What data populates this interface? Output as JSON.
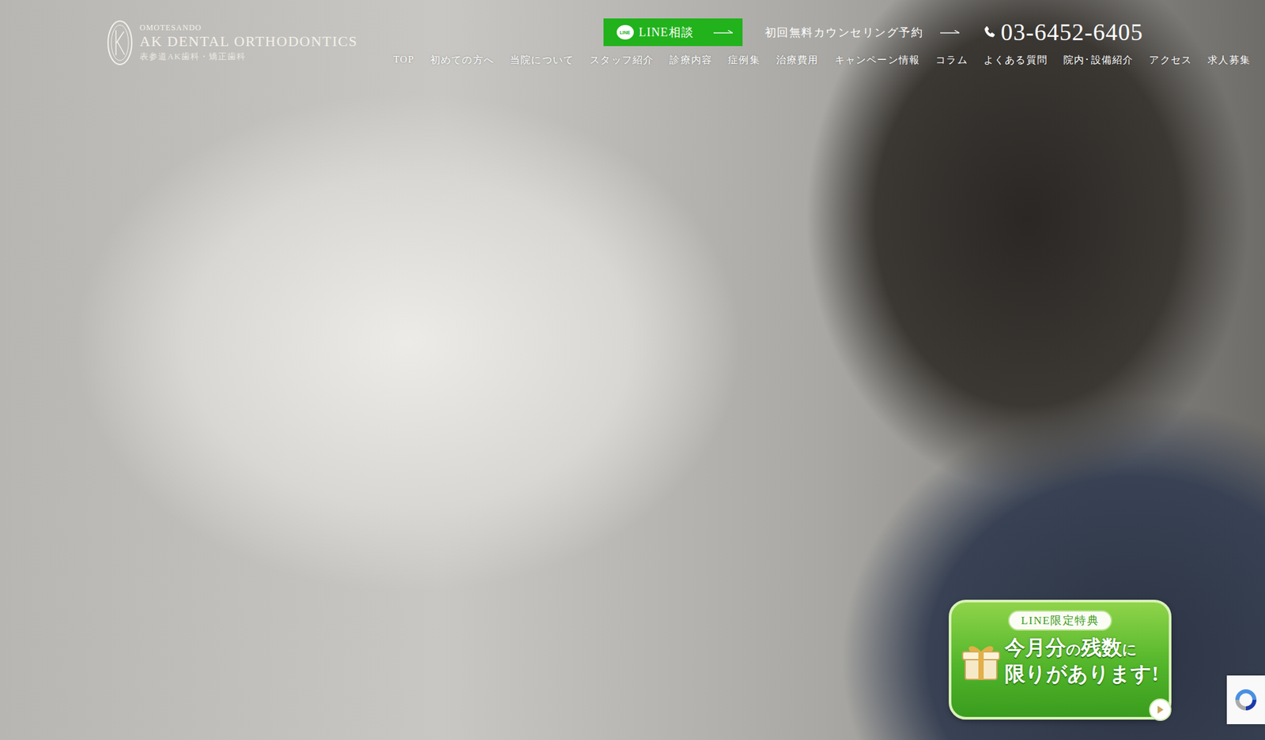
{
  "logo": {
    "area": "OMOTESANDO",
    "name": "AK DENTAL ORTHODONTICS",
    "subtitle": "表参道AK歯科・矯正歯科"
  },
  "header": {
    "line_icon": "LINE",
    "line_button": "LINE相談",
    "reservation": "初回無料カウンセリング予約",
    "phone": "03-6452-6405"
  },
  "nav": [
    {
      "label": "TOP",
      "selected": false
    },
    {
      "label": "初めての方へ",
      "selected": false
    },
    {
      "label": "当院について",
      "selected": false
    },
    {
      "label": "スタッフ紹介",
      "selected": false
    },
    {
      "label": "診療内容",
      "selected": false
    },
    {
      "label": "症例集",
      "selected": false
    },
    {
      "label": "治療費用",
      "selected": false
    },
    {
      "label": "キャンペーン情報",
      "selected": false
    },
    {
      "label": "コラム",
      "selected": false
    },
    {
      "label": "よくある質問",
      "selected": false
    },
    {
      "label": "院内･設備紹介",
      "selected": false
    },
    {
      "label": "アクセス",
      "selected": false
    },
    {
      "label": "求人募集",
      "selected": false
    }
  ],
  "badge": {
    "tag": "LINE限定特典",
    "lines": [
      [
        {
          "text": "今月分",
          "small": false
        },
        {
          "text": "の",
          "small": true
        },
        {
          "text": "残数",
          "small": false
        },
        {
          "text": "に",
          "small": true
        }
      ],
      [
        {
          "text": "限りがあります!",
          "small": false
        }
      ]
    ]
  }
}
